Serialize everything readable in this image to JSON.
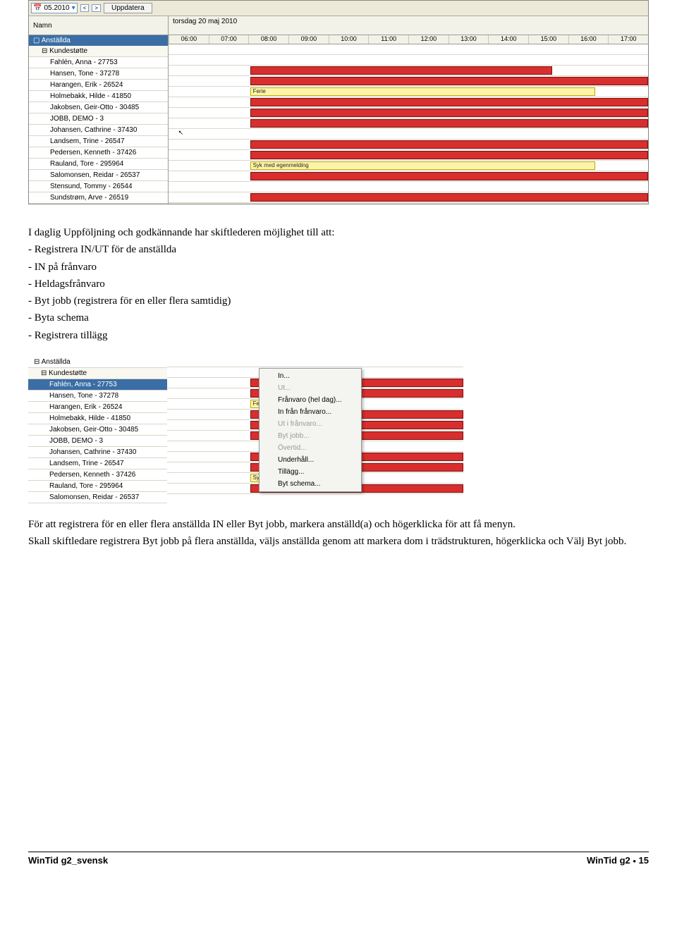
{
  "ss1": {
    "month": "05.2010",
    "update_btn": "Uppdatera",
    "name_col": "Namn",
    "date_header": "torsdag 20 maj 2010",
    "hours": [
      "06:00",
      "07:00",
      "08:00",
      "09:00",
      "10:00",
      "11:00",
      "12:00",
      "13:00",
      "14:00",
      "15:00",
      "16:00",
      "17:00"
    ],
    "group_root": "Anställda",
    "group_sub": "Kundestøtte",
    "employees": [
      "Fahlén, Anna - 27753",
      "Hansen, Tone - 37278",
      "Harangen, Erik - 26524",
      "Holmebakk, Hilde - 41850",
      "Jakobsen, Geir-Otto - 30485",
      "JOBB, DEMO - 3",
      "Johansen, Cathrine - 37430",
      "Landsem, Trine - 26547",
      "Pedersen, Kenneth - 37426",
      "Rauland, Tore - 295964",
      "Salomonsen, Reidar - 26537",
      "Stensund, Tommy - 26544",
      "Sundstrøm, Arve - 26519"
    ],
    "bar_ferie": "Ferie",
    "bar_syk": "Syk med egenmelding"
  },
  "body": {
    "p0": "I daglig Uppföljning och godkännande har skiftlederen möjlighet till att:",
    "b1": "- Registrera IN/UT för de anställda",
    "b2": "- IN  på frånvaro",
    "b3": "- Heldagsfrånvaro",
    "b4": "- Byt jobb (registrera för en eller flera samtidig)",
    "b5": "- Byta schema",
    "b6": "- Registrera tillägg"
  },
  "ss2": {
    "group_root": "Anställda",
    "group_sub": "Kundestøtte",
    "employees": [
      "Fahlén, Anna - 27753",
      "Hansen, Tone - 37278",
      "Harangen, Erik - 26524",
      "Holmebakk, Hilde - 41850",
      "Jakobsen, Geir-Otto - 30485",
      "JOBB, DEMO - 3",
      "Johansen, Cathrine - 37430",
      "Landsem, Trine - 26547",
      "Pedersen, Kenneth - 37426",
      "Rauland, Tore - 295964",
      "Salomonsen, Reidar - 26537"
    ],
    "bar_ferie": "Ferie",
    "bar_syk": "Syk.",
    "menu": [
      {
        "label": "In...",
        "enabled": true
      },
      {
        "label": "Ut...",
        "enabled": false
      },
      {
        "label": "Frånvaro (hel dag)...",
        "enabled": true
      },
      {
        "label": "In från frånvaro...",
        "enabled": true
      },
      {
        "label": "Ut i frånvaro...",
        "enabled": false
      },
      {
        "label": "Byt jobb...",
        "enabled": false
      },
      {
        "label": "Övertid...",
        "enabled": false
      },
      {
        "label": "Underhåll...",
        "enabled": true
      },
      {
        "label": "Tillägg...",
        "enabled": true
      },
      {
        "label": "Byt schema...",
        "enabled": true
      }
    ]
  },
  "body2": {
    "p1": "För att registrera för en eller flera anställda IN eller Byt jobb, markera anställd(a) och högerklicka för att få menyn.",
    "p2": "Skall skiftledare registrera Byt jobb på flera anställda, väljs anställda genom att markera dom i trädstrukturen, högerklicka och Välj Byt jobb."
  },
  "footer": {
    "left": "WinTid g2_svensk",
    "right_label": "WinTid g2",
    "page": "15"
  }
}
